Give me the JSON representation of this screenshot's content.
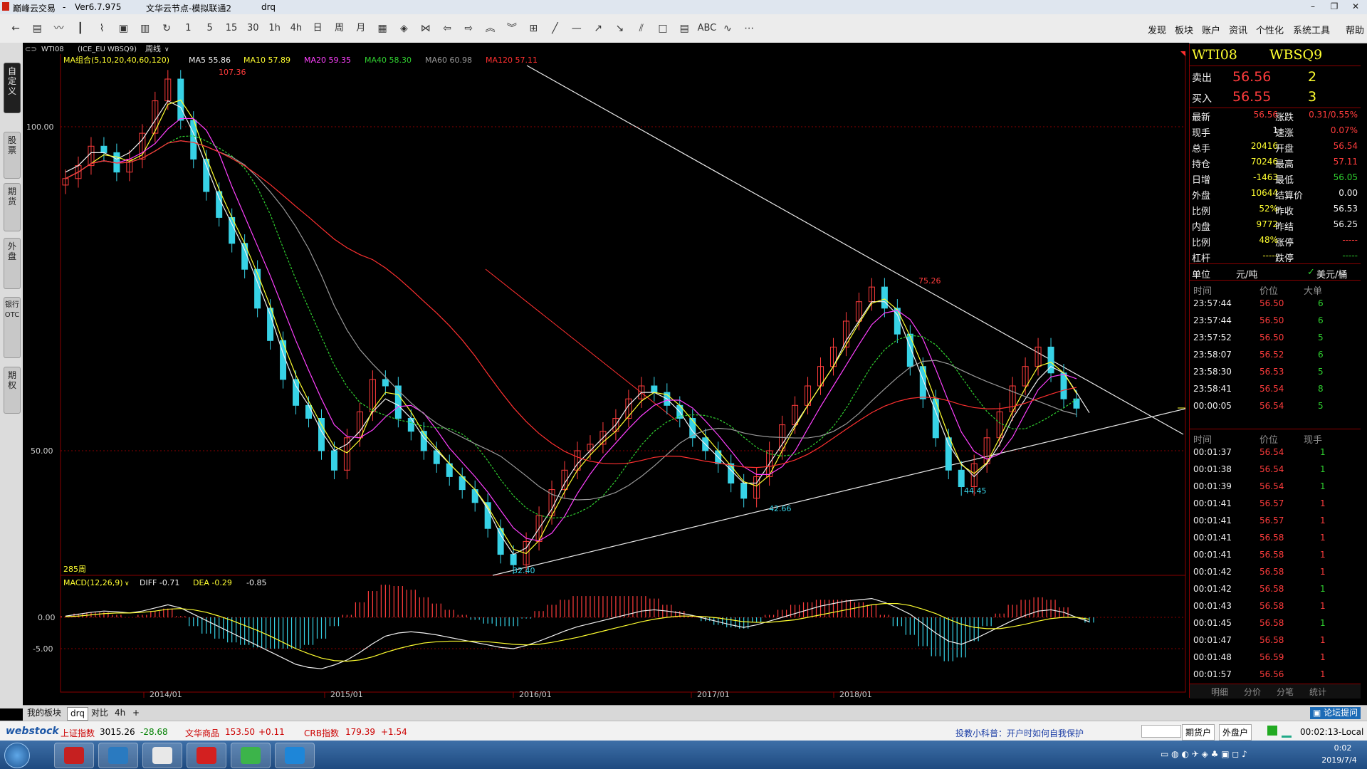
{
  "window": {
    "app_name": "巅峰云交易",
    "version": "Ver6.7.975",
    "node": "文华云节点-模拟联通2",
    "user": "drq"
  },
  "toolbar": {
    "icons": [
      "back-arrow-icon",
      "quote-table-icon",
      "line-chart-icon",
      "kline-icon",
      "fenshi-icon",
      "account-icon",
      "save-icon",
      "refresh-icon",
      "period-1-icon",
      "period-5-icon",
      "period-15-icon",
      "period-30-icon",
      "period-1h-icon",
      "period-4h-icon",
      "period-day-icon",
      "period-week-icon",
      "period-month-icon",
      "calculator-icon",
      "zoom-in-icon",
      "zoom-out-icon",
      "scroll-left-icon",
      "scroll-right-icon",
      "arrow-up-icon",
      "arrow-down-icon",
      "layout-icon",
      "draw-line-icon",
      "hline-icon",
      "ray-icon",
      "down-ray-icon",
      "parallel-icon",
      "rect-icon",
      "channel-icon",
      "abc-text-icon",
      "wave-icon",
      "more-icon"
    ],
    "labels": [
      "",
      "",
      "",
      "",
      "",
      "",
      "",
      "",
      "1",
      "5",
      "15",
      "30",
      "1h",
      "4h",
      "日",
      "周",
      "月",
      "",
      "",
      "",
      "",
      "",
      "",
      "",
      "",
      "",
      "",
      "",
      "",
      "",
      "",
      "",
      "ABC",
      "",
      ""
    ],
    "menu": [
      "发现",
      "板块",
      "账户",
      "资讯",
      "个性化",
      "系统工具",
      "帮助"
    ]
  },
  "left_tabs": [
    "自定义",
    "股票",
    "期货",
    "外盘",
    "银行OTC",
    "期权"
  ],
  "chart": {
    "header": {
      "symbol_tag": "WTI08",
      "contract": "(ICE_EU WBSQ9)",
      "period": "周线",
      "ma_group": "MA组合(5,10,20,40,60,120)",
      "ma5": "MA5 55.86",
      "ma10": "MA10 57.89",
      "ma20": "MA20 59.35",
      "ma40": "MA40 58.30",
      "ma60": "MA60 60.98",
      "ma120": "MA120 57.11"
    },
    "bars_label": "285周",
    "macd_header": {
      "title": "MACD(12,26,9)",
      "diff": "DIFF -0.71",
      "dea": "DEA -0.29",
      "macd": "-0.85"
    },
    "x_labels": [
      "2014/01",
      "2015/01",
      "2016/01",
      "2017/01",
      "2018/01"
    ],
    "annotations": [
      "107.36",
      "75.26",
      "42.66",
      "44.45",
      "32.40"
    ]
  },
  "chart_data": [
    {
      "type": "candlestick",
      "yticks": [
        "100.00",
        "50.00"
      ],
      "ylim": [
        30,
        110
      ],
      "x_range": [
        "2013/09",
        "2019/07"
      ],
      "series": [
        {
          "name": "price",
          "values": [
            92,
            94,
            97,
            96,
            93,
            95,
            99,
            104,
            107.36,
            101,
            95,
            90,
            86,
            82,
            78,
            72,
            67,
            61,
            57,
            55,
            50,
            47,
            52,
            56,
            61,
            60,
            55,
            53,
            50,
            48,
            46,
            44,
            42,
            38,
            34,
            32.4,
            36,
            40,
            44,
            47,
            50,
            51,
            53,
            55,
            58,
            60,
            59,
            57,
            55,
            52,
            50,
            48,
            45,
            42.66,
            46,
            50,
            54,
            57,
            60,
            63,
            66,
            70,
            73,
            75.26,
            72,
            68,
            63,
            58,
            52,
            47,
            44.45,
            48,
            52,
            56,
            60,
            63,
            66,
            62,
            58,
            56.56
          ]
        },
        {
          "name": "MA5",
          "values": [
            93,
            94,
            96,
            96,
            95,
            96,
            98,
            101,
            104,
            103,
            99,
            94,
            89,
            85,
            81,
            76,
            71,
            65,
            60,
            57,
            53,
            50,
            51,
            53,
            56,
            58,
            57,
            55,
            52,
            50,
            48,
            46,
            44,
            41,
            37,
            34,
            35,
            38,
            41,
            45,
            48,
            50,
            52,
            54,
            57,
            59,
            59,
            58,
            56,
            53,
            51,
            49,
            47,
            45,
            45,
            48,
            51,
            54,
            57,
            60,
            63,
            67,
            70,
            73,
            73,
            71,
            66,
            61,
            56,
            51,
            48,
            46,
            48,
            51,
            55,
            58,
            61,
            63,
            62,
            59,
            55.86
          ]
        }
      ]
    },
    {
      "type": "bar",
      "title": "MACD(12,26,9)",
      "yticks": [
        "0.00",
        "-5.00"
      ],
      "ylim": [
        -9,
        3
      ],
      "series": [
        {
          "name": "DIFF",
          "values": [
            0.2,
            0.5,
            0.8,
            1.0,
            0.9,
            0.7,
            1.0,
            1.5,
            2.0,
            1.5,
            0.5,
            -0.5,
            -1.5,
            -2.5,
            -3.5,
            -4.5,
            -5.5,
            -6.5,
            -7.5,
            -8.0,
            -8.2,
            -7.6,
            -6.8,
            -5.6,
            -4.2,
            -3.0,
            -2.5,
            -2.3,
            -2.5,
            -2.8,
            -3.2,
            -3.6,
            -4.0,
            -4.4,
            -4.8,
            -5.0,
            -4.5,
            -3.8,
            -3.0,
            -2.2,
            -1.5,
            -1.0,
            -0.5,
            0.0,
            0.5,
            1.0,
            1.2,
            1.0,
            0.7,
            0.3,
            -0.2,
            -0.7,
            -1.2,
            -1.6,
            -1.2,
            -0.6,
            0.0,
            0.6,
            1.2,
            1.8,
            2.2,
            2.6,
            2.8,
            3.0,
            2.4,
            1.5,
            0.5,
            -1.0,
            -2.5,
            -3.8,
            -4.3,
            -3.5,
            -2.5,
            -1.5,
            -0.5,
            0.3,
            1.0,
            1.2,
            0.8,
            0.0,
            -0.71
          ]
        },
        {
          "name": "DEA",
          "values": [
            0.1,
            0.2,
            0.4,
            0.6,
            0.7,
            0.7,
            0.8,
            1.0,
            1.3,
            1.4,
            1.2,
            0.8,
            0.2,
            -0.5,
            -1.3,
            -2.1,
            -3.0,
            -4.0,
            -5.0,
            -5.8,
            -6.5,
            -6.9,
            -7.0,
            -6.8,
            -6.3,
            -5.6,
            -5.0,
            -4.5,
            -4.1,
            -3.9,
            -3.8,
            -3.8,
            -3.8,
            -3.9,
            -4.1,
            -4.3,
            -4.4,
            -4.3,
            -4.0,
            -3.6,
            -3.2,
            -2.7,
            -2.2,
            -1.7,
            -1.2,
            -0.7,
            -0.3,
            0.0,
            0.2,
            0.2,
            0.1,
            -0.1,
            -0.4,
            -0.7,
            -0.8,
            -0.8,
            -0.6,
            -0.4,
            0.0,
            0.4,
            0.8,
            1.2,
            1.6,
            2.0,
            2.2,
            2.2,
            1.9,
            1.3,
            0.6,
            -0.3,
            -1.1,
            -1.6,
            -1.8,
            -1.8,
            -1.5,
            -1.1,
            -0.6,
            -0.2,
            0.0,
            0.0,
            -0.29
          ]
        }
      ]
    }
  ],
  "quote": {
    "symbol": "WTI08",
    "contract": "WBSQ9",
    "sell_label": "卖出",
    "sell_price": "56.56",
    "sell_vol": "2",
    "buy_label": "买入",
    "buy_price": "56.55",
    "buy_vol": "3",
    "rows": [
      {
        "l1": "最新",
        "v1": "56.56",
        "c1": "red",
        "l2": "涨跌",
        "v2": "0.31/0.55%",
        "c2": "red"
      },
      {
        "l1": "现手",
        "v1": "1",
        "c1": "white",
        "l2": "速涨",
        "v2": "0.07%",
        "c2": "red"
      },
      {
        "l1": "总手",
        "v1": "20416",
        "c1": "yellow",
        "l2": "开盘",
        "v2": "56.54",
        "c2": "red"
      },
      {
        "l1": "持仓",
        "v1": "70246",
        "c1": "yellow",
        "l2": "最高",
        "v2": "57.11",
        "c2": "red"
      },
      {
        "l1": "日增",
        "v1": "-1463",
        "c1": "yellow",
        "l2": "最低",
        "v2": "56.05",
        "c2": "green"
      },
      {
        "l1": "外盘",
        "v1": "10644",
        "c1": "yellow",
        "l2": "结算价",
        "v2": "0.00",
        "c2": "white"
      },
      {
        "l1": "比例",
        "v1": "52%",
        "c1": "yellow",
        "l2": "昨收",
        "v2": "56.53",
        "c2": "white"
      },
      {
        "l1": "内盘",
        "v1": "9772",
        "c1": "yellow",
        "l2": "昨结",
        "v2": "56.25",
        "c2": "white"
      },
      {
        "l1": "比例",
        "v1": "48%",
        "c1": "yellow",
        "l2": "涨停",
        "v2": "-----",
        "c2": "red"
      },
      {
        "l1": "杠杆",
        "v1": "-----",
        "c1": "yellow",
        "l2": "跌停",
        "v2": "-----",
        "c2": "green"
      }
    ],
    "unit_label": "单位",
    "unit_cny": "元/吨",
    "unit_usd": "美元/桶",
    "big_headers": [
      "时间",
      "价位",
      "大单"
    ],
    "big_orders": [
      [
        "23:57:44",
        "56.50",
        "6"
      ],
      [
        "23:57:44",
        "56.50",
        "6"
      ],
      [
        "23:57:52",
        "56.50",
        "5"
      ],
      [
        "23:58:07",
        "56.52",
        "6"
      ],
      [
        "23:58:30",
        "56.53",
        "5"
      ],
      [
        "23:58:41",
        "56.54",
        "8"
      ],
      [
        "00:00:05",
        "56.54",
        "5"
      ]
    ],
    "tick_headers": [
      "时间",
      "价位",
      "现手"
    ],
    "ticks": [
      [
        "00:01:37",
        "56.54",
        "1"
      ],
      [
        "00:01:38",
        "56.54",
        "1"
      ],
      [
        "00:01:39",
        "56.54",
        "1"
      ],
      [
        "00:01:41",
        "56.57",
        "1"
      ],
      [
        "00:01:41",
        "56.57",
        "1"
      ],
      [
        "00:01:41",
        "56.58",
        "1"
      ],
      [
        "00:01:41",
        "56.58",
        "1"
      ],
      [
        "00:01:42",
        "56.58",
        "1"
      ],
      [
        "00:01:42",
        "56.58",
        "1"
      ],
      [
        "00:01:43",
        "56.58",
        "1"
      ],
      [
        "00:01:45",
        "56.58",
        "1"
      ],
      [
        "00:01:47",
        "56.58",
        "1"
      ],
      [
        "00:01:48",
        "56.59",
        "1"
      ],
      [
        "00:01:57",
        "56.56",
        "1"
      ]
    ],
    "bottom_tabs": [
      "明细",
      "分价",
      "分笔",
      "统计"
    ]
  },
  "bottom": {
    "tabs": [
      "我的板块",
      "drq",
      "对比",
      "4h",
      "+"
    ],
    "forum": "论坛提问"
  },
  "ticker": {
    "logo": "webstock",
    "sh_label": "上证指数",
    "sh_val": "3015.26",
    "sh_chg": "-28.68",
    "wh_label": "文华商品",
    "wh_val": "153.50",
    "wh_chg": "+0.11",
    "crb_label": "CRB指数",
    "crb_val": "179.39",
    "crb_chg": "+1.54",
    "tip": "投教小科普：开户时如何自我保护",
    "btn_futures": "期货户",
    "btn_outer": "外盘户",
    "clock": "00:02:13-Local"
  },
  "taskbar": {
    "time": "0:02",
    "date": "2019/7/4",
    "apps": [
      "wh6-app",
      "feather-app",
      "chrome-app",
      "ff-app",
      "wechat-app",
      "blue-t-app"
    ]
  },
  "colors": {
    "up": "#ff3c3c",
    "down": "#37d2e6",
    "ma5": "#f0f0f0",
    "ma10": "#ffff30",
    "ma20": "#ff40ff",
    "ma40": "#30d030",
    "ma60": "#9a9a9a",
    "ma120": "#ff3030",
    "frame": "#8a0000",
    "trend": "#e8e8e8"
  }
}
